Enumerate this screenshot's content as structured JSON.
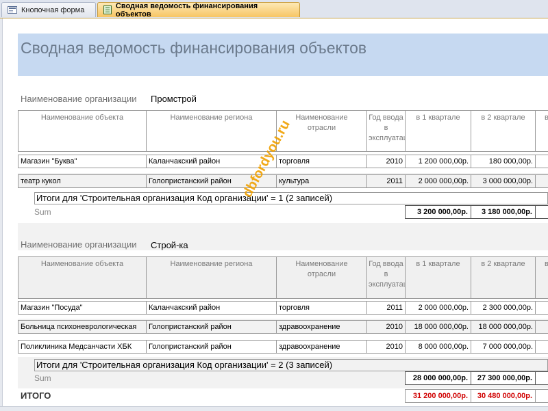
{
  "tabs": [
    {
      "label": "Кнопочная форма"
    },
    {
      "label": "Сводная ведомость финансирования объектов"
    }
  ],
  "report": {
    "title": "Сводная ведомость финансирования объектов",
    "group_label": "Наименование организации",
    "columns": [
      "Наименование объекта",
      "Наименование региона",
      "Наименование отрасли",
      "Год ввода в эксплуатацию",
      "в 1 квартале",
      "в 2 квартале",
      "в"
    ],
    "groups": [
      {
        "org": "Промстрой",
        "rows": [
          {
            "object": "Магазин \"Буква\"",
            "region": "Каланчакский район",
            "industry": "торговля",
            "year": "2010",
            "q1": "1 200 000,00р.",
            "q2": "180 000,00р."
          },
          {
            "object": "театр кукол",
            "region": "Голопристанский район",
            "industry": "культура",
            "year": "2011",
            "q1": "2 000 000,00р.",
            "q2": "3 000 000,00р."
          }
        ],
        "totals_text": "Итоги для 'Строительная организация  Код организации' =  1 (2 записей)",
        "sum_label": "Sum",
        "sum_q1": "3 200 000,00р.",
        "sum_q2": "3 180 000,00р."
      },
      {
        "org": "Строй-ка",
        "rows": [
          {
            "object": "Магазин \"Посуда\"",
            "region": "Каланчакский район",
            "industry": "торговля",
            "year": "2011",
            "q1": "2 000 000,00р.",
            "q2": "2 300 000,00р."
          },
          {
            "object": "Больница психоневрологическая",
            "region": "Голопристанский район",
            "industry": "здравоохранение",
            "year": "2010",
            "q1": "18 000 000,00р.",
            "q2": "18 000 000,00р."
          },
          {
            "object": "Поликлиника Медсанчасти ХБК",
            "region": "Голопристанский район",
            "industry": "здравоохранение",
            "year": "2010",
            "q1": "8 000 000,00р.",
            "q2": "7 000 000,00р."
          }
        ],
        "totals_text": "Итоги для 'Строительная организация  Код организации' =  2 (3 записей)",
        "sum_label": "Sum",
        "sum_q1": "28 000 000,00р.",
        "sum_q2": "27 300 000,00р."
      }
    ],
    "grand_label": "ИТОГО",
    "grand_q1": "31 200 000,00р.",
    "grand_q2": "30 480 000,00р."
  },
  "watermark": "dbfordyou.ru",
  "colors": {
    "title_band": "#c6d9f1",
    "grand_total": "#d00000",
    "active_tab": "#f7c563"
  }
}
